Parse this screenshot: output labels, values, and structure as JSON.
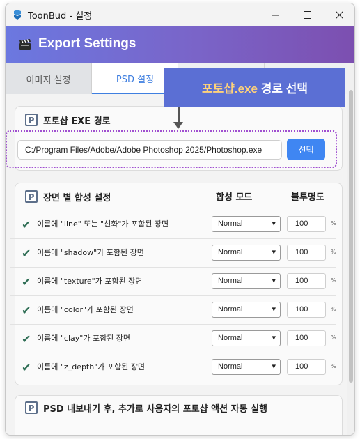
{
  "window": {
    "title": "ToonBud - 설정"
  },
  "header": {
    "title": "Export Settings",
    "icon": "clapperboard-icon"
  },
  "tabs": [
    {
      "label": "이미지 설정",
      "active": false
    },
    {
      "label": "PSD 설정",
      "active": true
    }
  ],
  "callout": {
    "highlight": "포토샵.exe",
    "rest": " 경로 선택"
  },
  "exe_section": {
    "title": "포토샵 EXE 경로",
    "path_value": "C:/Program Files/Adobe/Adobe Photoshop 2025/Photoshop.exe",
    "select_label": "선택"
  },
  "blend_section": {
    "title": "장면 별 합성 설정",
    "col_mode": "합성 모드",
    "col_opacity": "불투명도",
    "unit": "%",
    "rows": [
      {
        "label": "이름에 \"line\" 또는 \"선화\"가 포함된 장면",
        "mode": "Normal",
        "opacity": "100"
      },
      {
        "label": "이름에 \"shadow\"가 포함된 장면",
        "mode": "Normal",
        "opacity": "100"
      },
      {
        "label": "이름에 \"texture\"가 포함된 장면",
        "mode": "Normal",
        "opacity": "100"
      },
      {
        "label": "이름에 \"color\"가 포함된 장면",
        "mode": "Normal",
        "opacity": "100"
      },
      {
        "label": "이름에 \"clay\"가 포함된 장면",
        "mode": "Normal",
        "opacity": "100"
      },
      {
        "label": "이름에 \"z_depth\"가 포함된 장면",
        "mode": "Normal",
        "opacity": "100"
      }
    ]
  },
  "action_section": {
    "title": "PSD 내보내기 후, 추가로 사용자의 포토샵 액션 자동 실행"
  },
  "colors": {
    "accent": "#3f86f2",
    "header_start": "#6b78e0",
    "header_end": "#7c4fb0",
    "callout": "#5b6fd4",
    "highlight_border": "#a04fd0"
  }
}
